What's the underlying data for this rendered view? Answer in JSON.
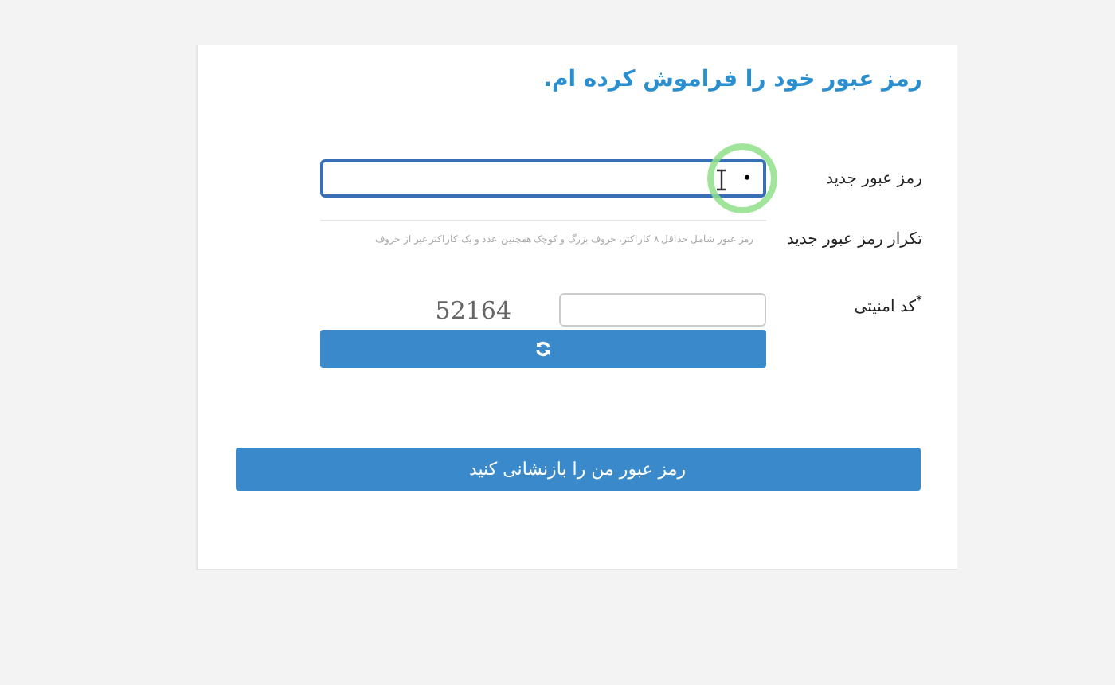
{
  "title": "رمز عبور خود را فراموش کرده ام.",
  "fields": [
    {
      "kind": "password",
      "label": "رمز عبور جدید",
      "value": "•",
      "focused": true
    },
    {
      "kind": "hint",
      "label": "تکرار رمز عبور جدید",
      "placeholder": "رمز عبور شامل حداقل ۸ کاراکتر، حروف بزرگ و کوچک همچنین عدد و یک کاراکتر غیر از حروف"
    }
  ],
  "captcha": {
    "label": "کد امنیتی",
    "required_mark": "*",
    "code": "52164"
  },
  "submit": "رمز عبور من را بازنشانی کنید"
}
